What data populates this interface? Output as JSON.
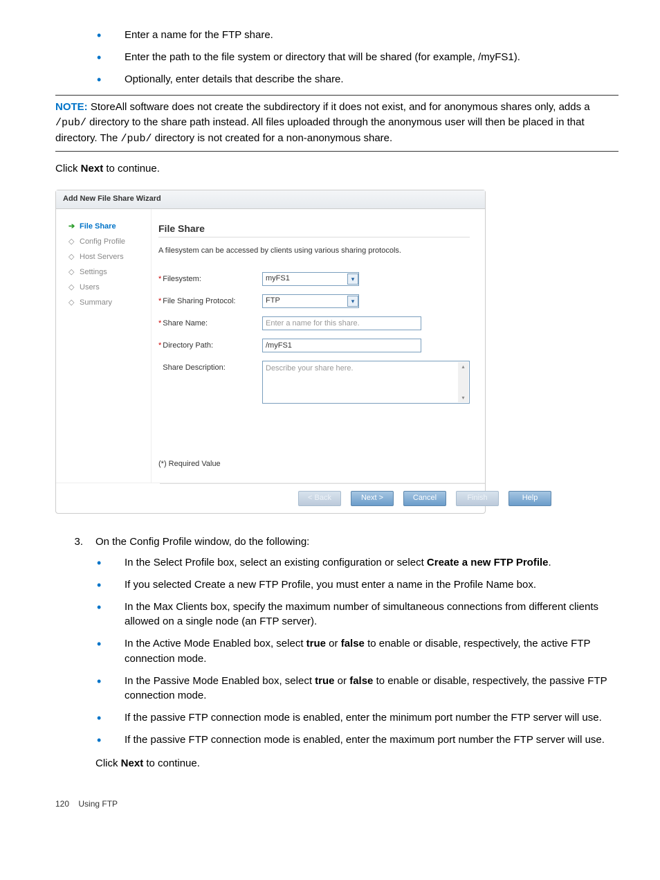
{
  "intro_bullets": [
    "Enter a name for the FTP share.",
    "Enter the path to the file system or directory that will be shared (for example, /myFS1).",
    "Optionally, enter details that describe the share."
  ],
  "note": {
    "label": "NOTE:",
    "text_a": "StoreAll software does not create the subdirectory if it does not exist, and for anonymous shares only, adds a ",
    "code_a": "/pub/",
    "text_b": " directory to the share path instead. All files uploaded through the anonymous user will then be placed in that directory. The ",
    "code_b": "/pub/",
    "text_c": " directory is not created for a non-anonymous share."
  },
  "click_next_a": "Click ",
  "click_next_b": "Next",
  "click_next_c": " to continue.",
  "wizard": {
    "title": "Add New File Share Wizard",
    "nav": {
      "arrow": "➔",
      "items": [
        "File Share",
        "Config Profile",
        "Host Servers",
        "Settings",
        "Users",
        "Summary"
      ]
    },
    "main": {
      "heading": "File Share",
      "desc": "A filesystem can be accessed by clients using various sharing protocols.",
      "fields": {
        "filesystem_label": "Filesystem:",
        "filesystem_value": "myFS1",
        "protocol_label": "File Sharing Protocol:",
        "protocol_value": "FTP",
        "sharename_label": "Share Name:",
        "sharename_placeholder": "Enter a name for this share.",
        "dirpath_label": "Directory Path:",
        "dirpath_value": "/myFS1",
        "desc_label": "Share Description:",
        "desc_placeholder": "Describe your share here."
      },
      "required_note": "(*) Required Value"
    },
    "buttons": {
      "back": "< Back",
      "next": "Next >",
      "cancel": "Cancel",
      "finish": "Finish",
      "help": "Help"
    }
  },
  "step3": {
    "num": "3.",
    "intro": "On the Config Profile window, do the following:",
    "bullets": [
      {
        "pre": "In the Select Profile box, select an existing configuration or select ",
        "bold": "Create a new FTP Profile",
        "post": "."
      },
      {
        "pre": "If you selected Create a new FTP Profile, you must enter a name in the Profile Name box.",
        "bold": "",
        "post": ""
      },
      {
        "pre": "In the Max Clients box, specify the maximum number of simultaneous connections from different clients allowed on a single node (an FTP server).",
        "bold": "",
        "post": ""
      },
      {
        "pre": "In the Active Mode Enabled box, select ",
        "bold": "true",
        "mid": " or ",
        "bold2": "false",
        "post": " to enable or disable, respectively, the active FTP connection mode."
      },
      {
        "pre": "In the Passive Mode Enabled box, select ",
        "bold": "true",
        "mid": " or ",
        "bold2": "false",
        "post": " to enable or disable, respectively, the passive FTP connection mode."
      },
      {
        "pre": "If the passive FTP connection mode is enabled, enter the minimum port number the FTP server will use.",
        "bold": "",
        "post": ""
      },
      {
        "pre": "If the passive FTP connection mode is enabled, enter the maximum port number the FTP server will use.",
        "bold": "",
        "post": ""
      }
    ]
  },
  "footer": {
    "page_num": "120",
    "section": "Using FTP"
  }
}
